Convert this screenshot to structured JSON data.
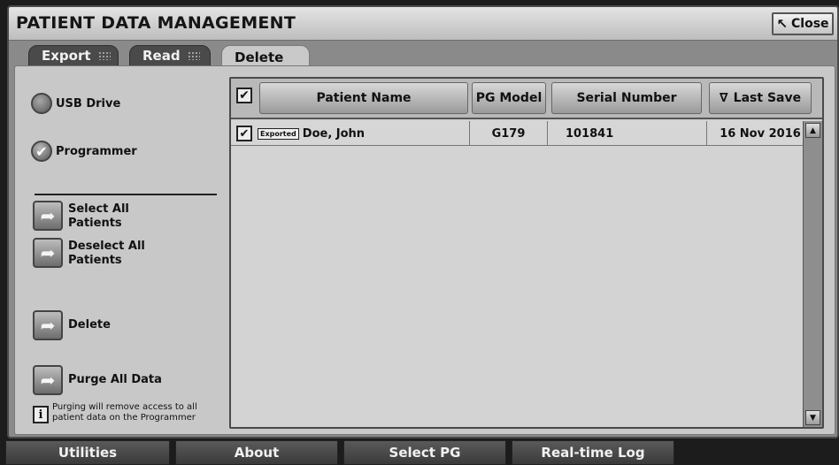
{
  "window": {
    "title": "PATIENT DATA MANAGEMENT",
    "close_label": "Close"
  },
  "tabs": [
    {
      "label": "Export",
      "active": false
    },
    {
      "label": "Read",
      "active": false
    },
    {
      "label": "Delete",
      "active": true
    }
  ],
  "source": {
    "options": [
      {
        "label": "USB Drive",
        "selected": false
      },
      {
        "label": "Programmer",
        "selected": true
      }
    ]
  },
  "actions": {
    "select_all": "Select All Patients",
    "deselect_all": "Deselect All Patients",
    "delete": "Delete",
    "purge_all": "Purge All Data",
    "purge_note": "Purging will remove access to all patient data on the Programmer"
  },
  "table": {
    "columns": [
      "Patient Name",
      "PG Model",
      "Serial Number",
      "Last Save"
    ],
    "sorted_column": "Last Save",
    "rows": [
      {
        "checked": true,
        "badge": "Exported",
        "patient_name": "Doe, John",
        "pg_model": "G179",
        "serial_number": "101841",
        "last_save": "16 Nov 2016"
      }
    ]
  },
  "taskbar": [
    "Utilities",
    "About",
    "Select PG",
    "Real-time Log"
  ]
}
